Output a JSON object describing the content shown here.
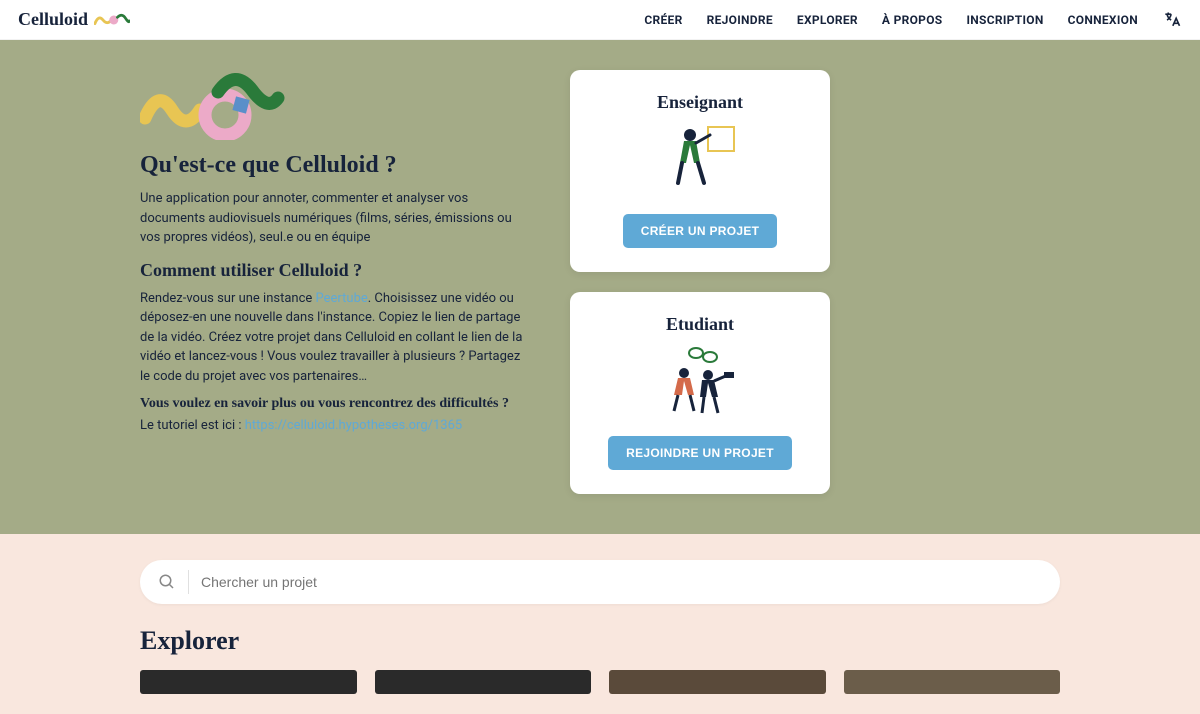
{
  "brand": "Celluloid",
  "nav": {
    "create": "CRÉER",
    "join": "REJOINDRE",
    "explore": "EXPLORER",
    "about": "À PROPOS",
    "signup": "INSCRIPTION",
    "login": "CONNEXION"
  },
  "hero": {
    "h2": "Qu'est-ce que Celluloid ?",
    "p1": "Une application pour annoter, commenter et analyser vos documents audiovisuels numériques (films, séries, émissions ou vos propres vidéos), seul.e ou en équipe",
    "h3": "Comment utiliser Celluloid ?",
    "p2a": "Rendez-vous sur une instance ",
    "peertube": "Peertube",
    "p2b": ". Choisissez une vidéo ou déposez-en une nouvelle dans l'instance. Copiez le lien de partage de la vidéo. Créez votre projet dans Celluloid en collant le lien de la vidéo et lancez-vous ! Vous voulez travailler à plusieurs ? Partagez le code du projet avec vos partenaires…",
    "h4": "Vous voulez en savoir plus ou vous rencontrez des difficultés ?",
    "p3a": "Le tutoriel est ici : ",
    "tutorial_link": "https://celluloid.hypotheses.org/1365"
  },
  "cards": {
    "teacher": {
      "title": "Enseignant",
      "button": "CRÉER UN PROJET"
    },
    "student": {
      "title": "Etudiant",
      "button": "REJOINDRE UN PROJET"
    }
  },
  "search": {
    "placeholder": "Chercher un projet"
  },
  "explore": {
    "title": "Explorer"
  }
}
